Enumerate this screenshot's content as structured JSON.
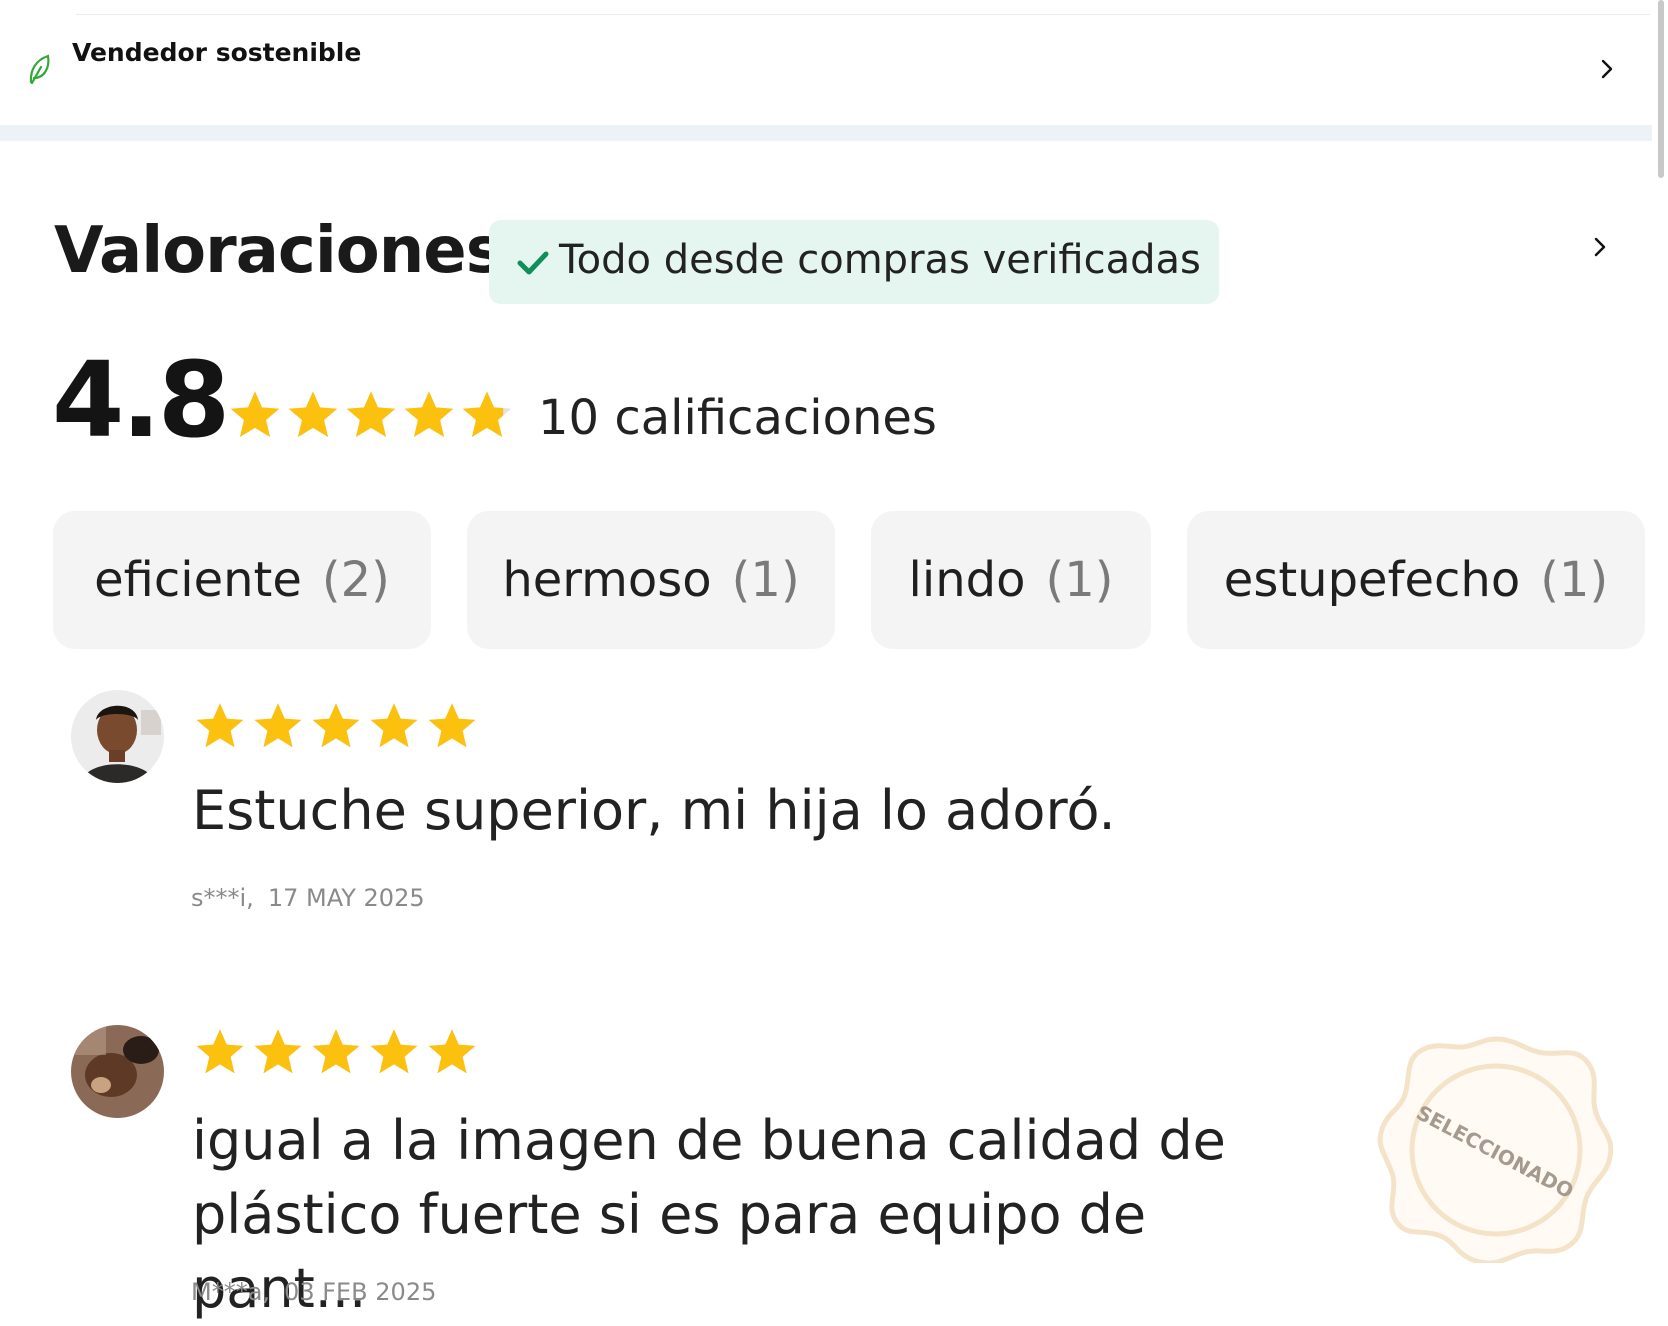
{
  "seller": {
    "label": "Vendedor sostenible"
  },
  "reviews_section": {
    "title": "Valoraciones",
    "verified_badge": "Todo desde compras verificadas",
    "average": "4.8",
    "average_stars": 4.8,
    "ratings_count": "10 calificaciones",
    "tags": [
      {
        "label": "eficiente",
        "count": "(2)"
      },
      {
        "label": "hermoso",
        "count": "(1)"
      },
      {
        "label": "lindo",
        "count": "(1)"
      },
      {
        "label": "estupefecho",
        "count": "(1)"
      }
    ],
    "reviews": [
      {
        "stars": 5,
        "text": "Estuche superior, mi hija lo adoró.",
        "author": "s***i,",
        "date": "17 MAY 2025"
      },
      {
        "stars": 5,
        "text": "igual a la imagen de buena calidad de plástico fuerte si es para equipo de pant...",
        "author": "M***a,",
        "date": "03 FEB 2025",
        "badge": "SELECCIONADO"
      }
    ]
  },
  "colors": {
    "star": "#fcc00f",
    "verified_bg": "#e4f6ef",
    "verified_check": "#0f8f5a",
    "leaf": "#35a83a",
    "divider": "#edf2f9"
  }
}
